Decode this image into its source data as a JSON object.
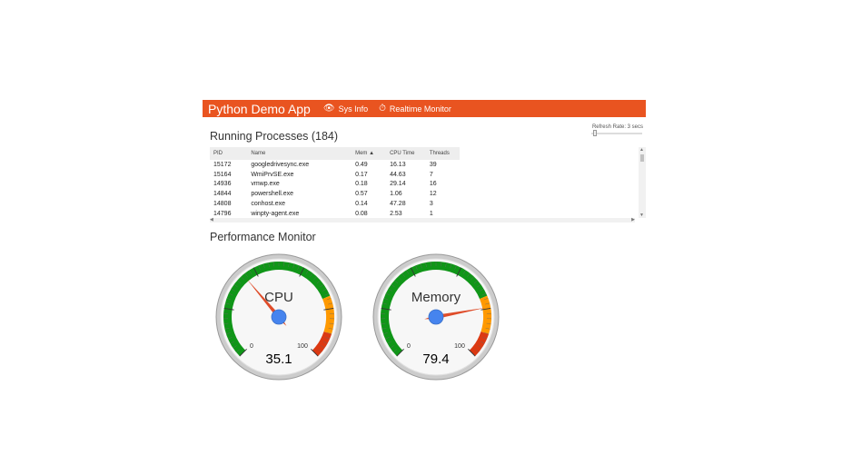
{
  "navbar": {
    "brand": "Python Demo App",
    "links": [
      {
        "label": "Sys Info",
        "icon": "eye-icon"
      },
      {
        "label": "Realtime Monitor",
        "icon": "clock-icon"
      }
    ],
    "color": "#e95420"
  },
  "refresh": {
    "label": "Refresh Rate: 3 secs"
  },
  "processes": {
    "title": "Running Processes (184)",
    "columns": [
      "PID",
      "Name",
      "Mem ▲",
      "CPU Time",
      "Threads"
    ],
    "rows": [
      [
        "15172",
        "googledrivesync.exe",
        "0.49",
        "16.13",
        "39"
      ],
      [
        "15164",
        "WmiPrvSE.exe",
        "0.17",
        "44.63",
        "7"
      ],
      [
        "14936",
        "vmwp.exe",
        "0.18",
        "29.14",
        "16"
      ],
      [
        "14844",
        "powershell.exe",
        "0.57",
        "1.06",
        "12"
      ],
      [
        "14808",
        "conhost.exe",
        "0.14",
        "47.28",
        "3"
      ],
      [
        "14796",
        "winpty-agent.exe",
        "0.08",
        "2.53",
        "1"
      ]
    ]
  },
  "performance": {
    "title": "Performance Monitor",
    "gauges": [
      {
        "label": "CPU",
        "value": 35.1,
        "display": "35.1",
        "min": "0",
        "max": "100"
      },
      {
        "label": "Memory",
        "value": 79.4,
        "display": "79.4",
        "min": "0",
        "max": "100"
      }
    ],
    "colors": {
      "green": "#109618",
      "yellow": "#ff9900",
      "red": "#dc3912",
      "needle": "#dc3912",
      "hub": "#4684ee"
    }
  }
}
